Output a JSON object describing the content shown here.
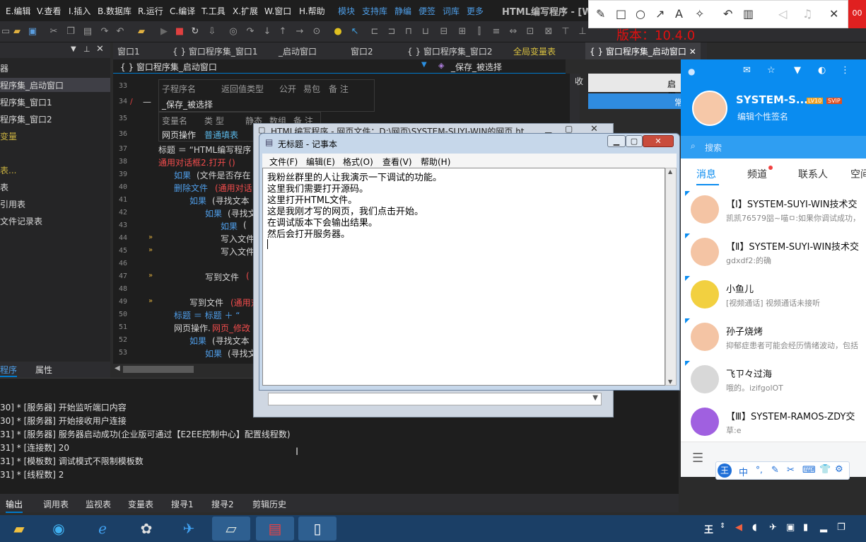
{
  "ide": {
    "title": "HTML编写程序 - [W",
    "menu": [
      "E.编辑",
      "V.查看",
      "I.插入",
      "B.数据库",
      "R.运行",
      "C.编译",
      "T.工具",
      "X.扩展",
      "W.窗口",
      "H.帮助"
    ],
    "menu_links": [
      "模块",
      "支持库",
      "静编",
      "便签",
      "词库",
      "更多"
    ],
    "doc_tabs": [
      "窗口1",
      "{ } 窗口程序集_窗口1",
      "_启动窗口",
      "窗口2",
      "{ } 窗口程序集_窗口2",
      "全局变量表",
      "{ } 窗口程序集_启动窗口"
    ],
    "proc_left": "{ } 窗口程序集_启动窗口",
    "proc_right": "_保存_被选择",
    "left_tree": [
      "器",
      "程序集_启动窗口",
      "程序集_窗口1",
      "程序集_窗口2",
      "变量",
      "表...",
      "表",
      "引用表",
      "文件记录表"
    ],
    "left_tabs": [
      "程序",
      "属性"
    ],
    "sub_table_headers": [
      "子程序名",
      "返回值类型",
      "公开",
      "易包",
      "备 注"
    ],
    "sub_name": "_保存_被选择",
    "var_table_headers": [
      "变量名",
      "类 型",
      "静态",
      "数组",
      "备 注"
    ],
    "var_row": [
      "网页操作",
      "普通填表"
    ],
    "line_numbers": [
      "33",
      "34",
      "35",
      "36",
      "37",
      "38",
      "39",
      "40",
      "41",
      "42",
      "43",
      "44",
      "45",
      "46",
      "47",
      "48",
      "49",
      "50",
      "51",
      "52",
      "53"
    ],
    "code": {
      "l37": "标题 ＝ “HTML编写程序",
      "l38": "通用对话框2.打开 ()",
      "l39a": "如果",
      "l39b": "(文件是否存在",
      "l40a": "删除文件",
      "l40b": "(通用对话",
      "l41a": "如果",
      "l41b": "(寻找文本",
      "l42a": "如果",
      "l42b": "(寻找文",
      "l43a": "如果",
      "l43b": "(",
      "l44": "写入文件",
      "l45": "写入文件",
      "l47a": "写到文件",
      "l47b": "(",
      "l49a": "写到文件",
      "l49b": "(通用对",
      "l50": "标题 ＝ 标题 ＋ “",
      "l51a": "网页操作.",
      "l51b": "网页_修改",
      "l52a": "如果",
      "l52b": "(寻找文本",
      "l53a": "如果",
      "l53b": "(寻找文"
    },
    "output_lines": [
      "30] * [服务器] 开始监听端口内容",
      "30] * [服务器] 开始接收用户连接",
      "31] * [服务器] 服务器启动成功(企业版可通过【E2EE控制中心】配置线程数)",
      "31] *      [连接数] 20",
      "31] *      [模板数] 调试模式不限制模板数",
      "31] *      [线程数] 2"
    ],
    "bottom_tabs": [
      "输出",
      "调用表",
      "监视表",
      "变量表",
      "搜寻1",
      "搜寻2",
      "剪辑历史"
    ],
    "right_labels": [
      "收",
      "启用",
      "常"
    ]
  },
  "bg_window": {
    "title": "HTML编写程序 - 网页文件：D:\\网页\\SYSTEM-SUYI-WIN的网页.ht"
  },
  "notepad": {
    "title": "无标题 - 记事本",
    "menu": [
      "文件(F)",
      "编辑(E)",
      "格式(O)",
      "查看(V)",
      "帮助(H)"
    ],
    "lines": [
      "我粉丝群里的人让我演示一下调试的功能。",
      "这里我们需要打开源码。",
      "这里打开HTML文件。",
      "这是我刚才写的网页，我们点击开始。",
      "在调试版本下会输出结果。",
      "然后会打开服务器。"
    ]
  },
  "overlay": {
    "version_text": "版本：10.4.0",
    "corner_text": "00"
  },
  "qq": {
    "name": "SYSTEM-S...",
    "level": "LV10",
    "vip": "SVIP",
    "signature": "编辑个性签名",
    "search_placeholder": "搜索",
    "tabs": [
      "消息",
      "频道",
      "联系人",
      "空间"
    ],
    "chats": [
      {
        "name": "【Ⅰ】SYSTEM-SUYI-WIN技术交",
        "msg": "凯凯76579㗊~喵ㅁ:如果你调试成功，"
      },
      {
        "name": "【Ⅱ】SYSTEM-SUYI-WIN技术交",
        "msg": "gdxdf2:的确"
      },
      {
        "name": "小鱼儿",
        "msg": "[视频通话] 视频通话未接听"
      },
      {
        "name": "孙子烧烤",
        "msg": "抑郁症患者可能会经历情绪波动，包括"
      },
      {
        "name": "飞ㄗ々过海",
        "msg": "哦的。izifgolOT"
      },
      {
        "name": "【Ⅲ】SYSTEM-RAMOS-ZDY交",
        "msg": "草:e"
      }
    ],
    "colors": {
      "accent": "#0a8cf0"
    }
  },
  "ime": {
    "items": [
      "王",
      "中",
      "°,",
      "✎",
      "✂",
      "⌨",
      "👕",
      "⚙"
    ]
  },
  "taskbar": {
    "apps": [
      "file-explorer-icon",
      "edge-icon",
      "ie-icon",
      "tool-icon",
      "qq-bird-icon",
      "notepad-icon",
      "e-language-icon",
      "document-icon"
    ],
    "tray_ime": "王"
  }
}
